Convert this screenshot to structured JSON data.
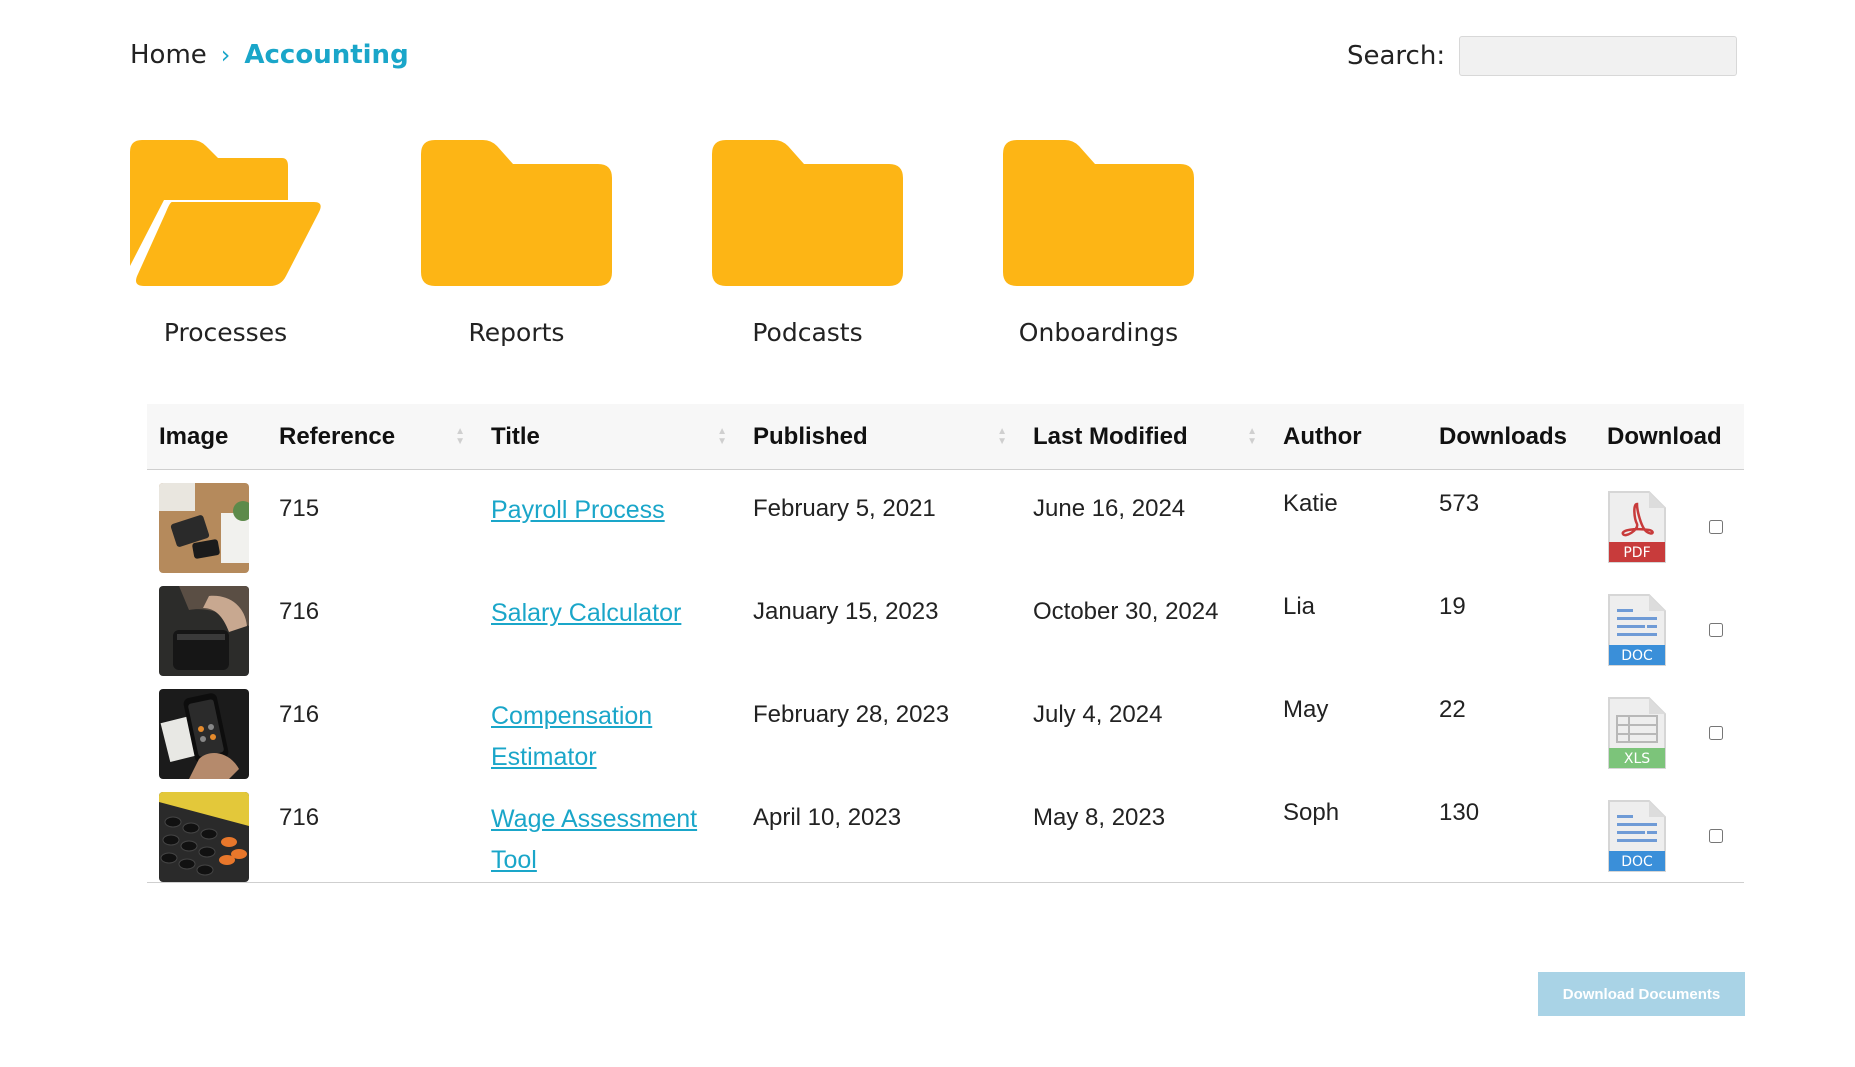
{
  "breadcrumb": {
    "home": "Home",
    "separator": "›",
    "current": "Accounting"
  },
  "search": {
    "label": "Search:",
    "value": "",
    "placeholder": ""
  },
  "folders": [
    {
      "label": "Processes",
      "icon": "folder-open-icon"
    },
    {
      "label": "Reports",
      "icon": "folder-icon"
    },
    {
      "label": "Podcasts",
      "icon": "folder-icon"
    },
    {
      "label": "Onboardings",
      "icon": "folder-icon"
    }
  ],
  "table": {
    "columns": {
      "image": "Image",
      "reference": "Reference",
      "title": "Title",
      "published": "Published",
      "modified": "Last Modified",
      "author": "Author",
      "downloads": "Downloads",
      "download": "Download"
    },
    "rows": [
      {
        "reference": "715",
        "title": "Payroll Process",
        "published": "February 5, 2021",
        "modified": "June 16, 2024",
        "author": "Katie",
        "downloads": "573",
        "file_type": "PDF"
      },
      {
        "reference": "716",
        "title": "Salary Calculator",
        "published": "January 15, 2023",
        "modified": "October 30, 2024",
        "author": "Lia",
        "downloads": "19",
        "file_type": "DOC"
      },
      {
        "reference": "716",
        "title": "Compensation Estimator",
        "published": "February 28, 2023",
        "modified": "July 4, 2024",
        "author": "May",
        "downloads": "22",
        "file_type": "XLS"
      },
      {
        "reference": "716",
        "title": "Wage Assessment Tool",
        "published": "April 10, 2023",
        "modified": "May 8, 2023",
        "author": "Soph",
        "downloads": "130",
        "file_type": "DOC"
      }
    ]
  },
  "download_button": "Download Documents",
  "colors": {
    "accent": "#1aa6c9",
    "folder": "#fdb515",
    "pdf": "#c83b3b",
    "doc": "#3a8fd9",
    "xls": "#7cc47a",
    "button": "#a9d3e6"
  }
}
